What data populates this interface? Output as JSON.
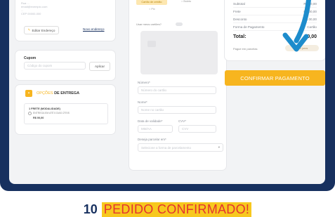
{
  "left_card": {
    "address_lines": [
      "Rua ...",
      "email@exemplo.com",
      "...",
      "CEP 00000-000"
    ],
    "change_address_label": "Editar Endereço",
    "new_address_label": "Novo endereço"
  },
  "coupon": {
    "title": "Cupom",
    "placeholder": "Código do cupom",
    "apply_label": "Aplicar"
  },
  "delivery": {
    "title_prefix": "OPÇÕES",
    "title_suffix": "DE ENTREGA",
    "option_title": "1 FRETE (MODALIDADE)",
    "option_desc": "ENTREGA EM ATÉ 5 DIAS ÚTEIS",
    "option_price": "R$ 00,00"
  },
  "payment": {
    "method_active": "Cartão de crédito",
    "method_other": "Boleto",
    "method_pix": "Pix",
    "saved_cards_label": "Usar meus cartões?",
    "fields": [
      {
        "label": "Número*",
        "placeholder": "Número do cartão"
      },
      {
        "label": "Nome*",
        "placeholder": "Nome no cartão"
      }
    ],
    "expiry_label": "Data de validade*",
    "cvv_label": "CVV*",
    "expiry_placeholder": "MM/AA",
    "cvv_placeholder": "CVV",
    "installments_label": "Deseja parcelar em*",
    "installments_value": "Selecione a forma de parcelamento"
  },
  "summary": {
    "rows": [
      {
        "label": "Subtotal",
        "value": "R$ 00,00"
      },
      {
        "label": "Frete",
        "value": "R$ 00,00"
      },
      {
        "label": "Desconto",
        "value": "R$ 00,00"
      },
      {
        "label": "Forma de Pagamento",
        "value": "Cartão"
      }
    ],
    "total_label": "Total:",
    "total_value": "0,00",
    "installment_note": "Pague em parcelas",
    "installment_badge": "sem juros"
  },
  "confirm_label": "CONFIRMAR PAGAMENTO",
  "caption": {
    "number": "10",
    "text": "PEDIDO CONFIRMADO!"
  },
  "colors": {
    "frame": "#17305f",
    "accent": "#f7b51f",
    "arrow": "#1d8ccc",
    "caption_text": "#e3342f"
  }
}
